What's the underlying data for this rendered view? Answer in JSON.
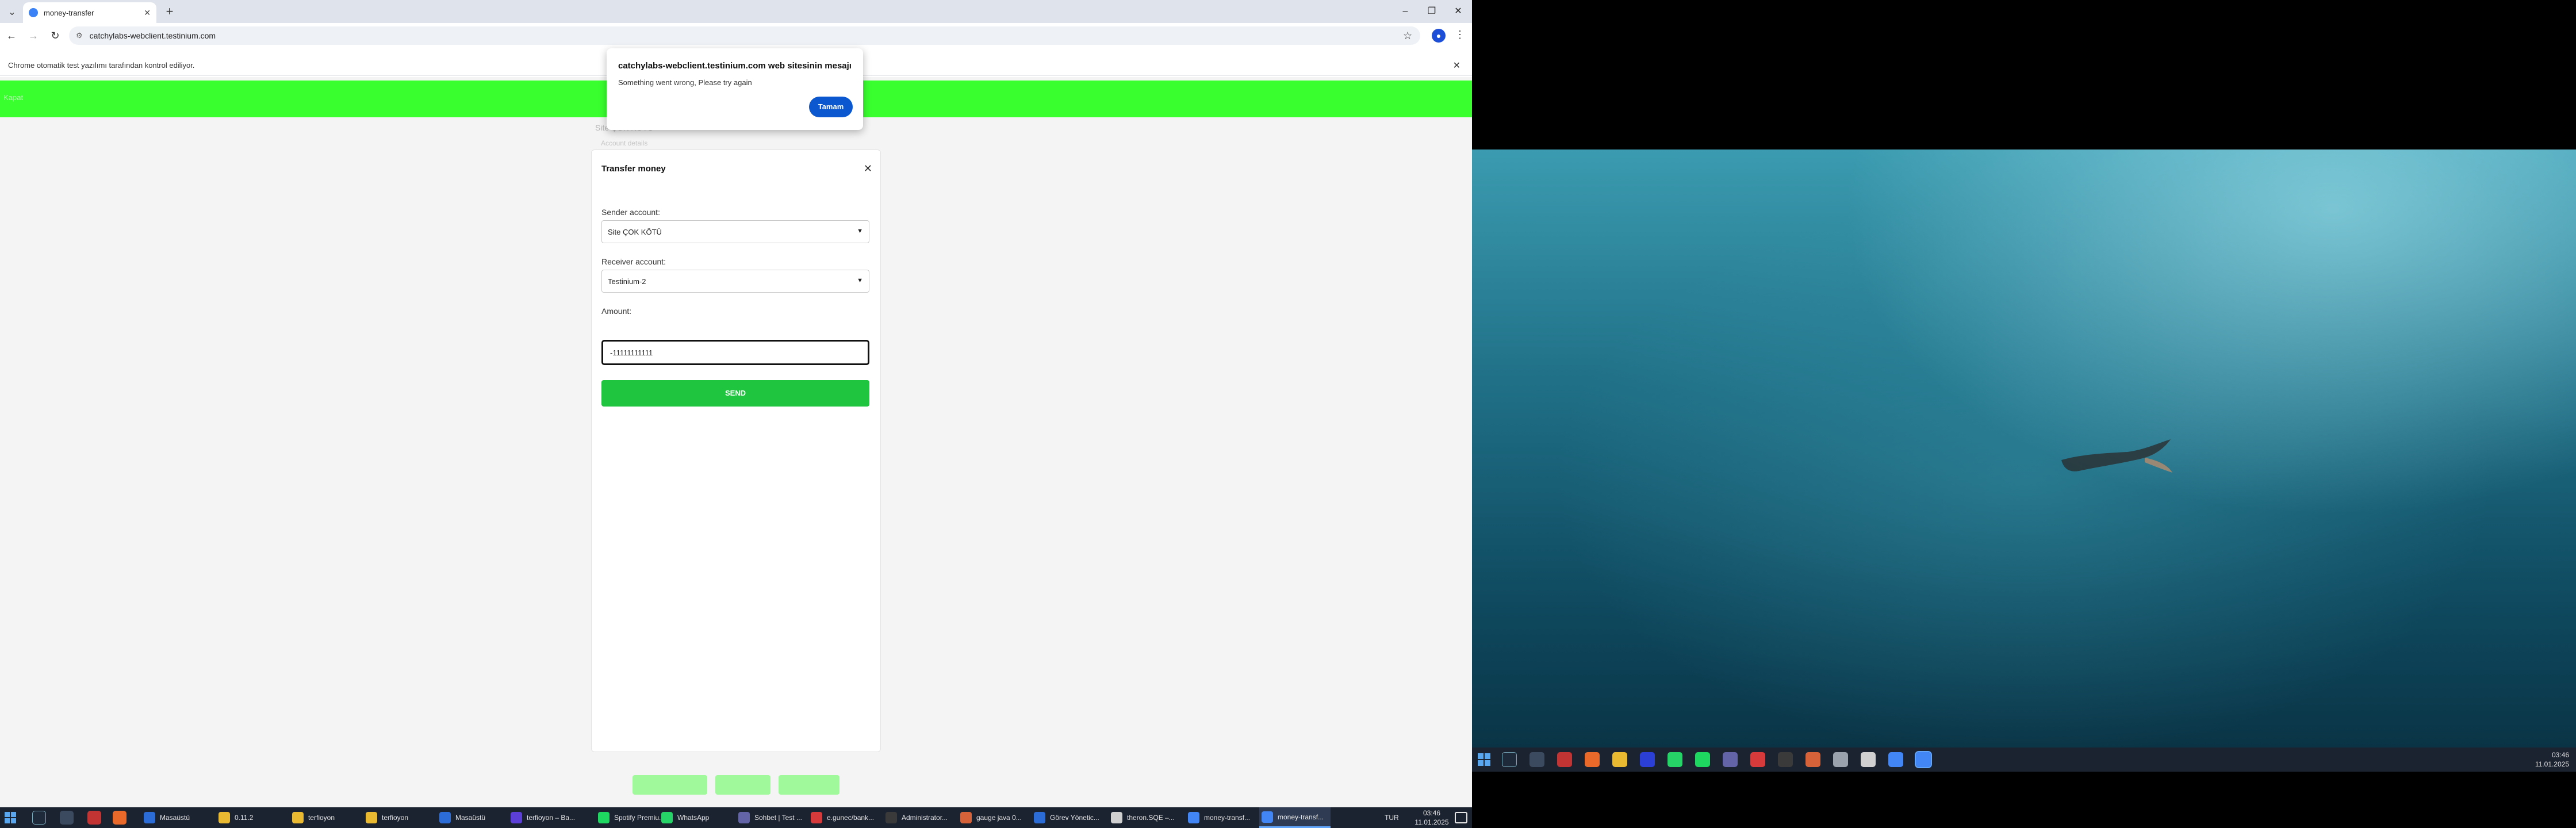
{
  "browser": {
    "tab_title": "money-transfer",
    "url": "catchylabs-webclient.testinium.com",
    "infobar_text": "Chrome otomatik test yazılımı tarafından kontrol ediliyor."
  },
  "page": {
    "nav_logout": "Kapat",
    "bg_name": "Site ÇOK KÖTÜ",
    "bg_sub": "Account details"
  },
  "modal": {
    "title": "Transfer money",
    "sender_label": "Sender account:",
    "sender_value": "Site ÇOK KÖTÜ",
    "receiver_label": "Receiver account:",
    "receiver_value": "Testinium-2",
    "amount_label": "Amount:",
    "amount_value": "-11111111111",
    "send_label": "SEND"
  },
  "alert": {
    "title": "catchylabs-webclient.testinium.com web sitesinin mesajı",
    "message": "Something went wrong, Please try again",
    "ok_label": "Tamam"
  },
  "taskbar_left": {
    "items": [
      {
        "label": "Masaüstü",
        "color": "#2b6cd6"
      },
      {
        "label": "0.11.2",
        "color": "#e8b931"
      },
      {
        "label": "terfioyon",
        "color": "#e8b931"
      },
      {
        "label": "terfioyon",
        "color": "#e8b931"
      },
      {
        "label": "Masaüstü",
        "color": "#2b6cd6"
      },
      {
        "label": "terfioyon – Ba...",
        "color": "#5b3fd6"
      },
      {
        "label": "Spotify Premiu...",
        "color": "#1ed760"
      },
      {
        "label": "WhatsApp",
        "color": "#25d366"
      },
      {
        "label": "Sohbet | Test ...",
        "color": "#6264a7"
      },
      {
        "label": "e.gunec/bank...",
        "color": "#d63a3a"
      },
      {
        "label": "Administrator...",
        "color": "#3a3a3a"
      },
      {
        "label": "gauge java 0...",
        "color": "#d6623a"
      },
      {
        "label": "Görev Yönetic...",
        "color": "#2b6cd6"
      },
      {
        "label": "theron.SQE –...",
        "color": "#d0d0d0"
      },
      {
        "label": "money-transf...",
        "color": "#4285f4"
      },
      {
        "label": "money-transf...",
        "color": "#4285f4"
      }
    ],
    "lang": "TUR",
    "time": "03:46",
    "date": "11.01.2025"
  },
  "taskbar_right": {
    "time": "03:46",
    "date": "11.01.2025"
  },
  "icons": {
    "tab_menu": "chevron-down-icon",
    "close": "close-icon",
    "new_tab": "plus-icon",
    "back": "back-arrow-icon",
    "forward": "forward-arrow-icon",
    "reload": "reload-icon",
    "bookmark": "star-icon",
    "profile": "person-icon",
    "menu": "kebab-menu-icon"
  },
  "colors": {
    "nav_green": "#39ff2e",
    "send_green": "#1fc43f",
    "alert_button": "#0b57d0"
  }
}
